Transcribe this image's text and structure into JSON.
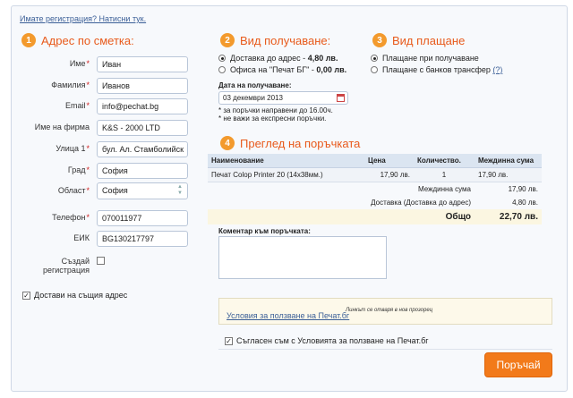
{
  "top_link": "Имате регистрация? Натисни тук.",
  "section1": {
    "num": "1",
    "title": "Адрес по сметка:",
    "fields": {
      "first_name": {
        "label": "Име",
        "value": "Иван"
      },
      "last_name": {
        "label": "Фамилия",
        "value": "Иванов"
      },
      "email": {
        "label": "Email",
        "value": "info@pechat.bg"
      },
      "company": {
        "label": "Име на фирма",
        "value": "K&S - 2000 LTD"
      },
      "street": {
        "label": "Улица 1",
        "value": "бул. Ал. Стамболийск"
      },
      "city": {
        "label": "Грaд",
        "value": "София"
      },
      "region": {
        "label": "Област",
        "value": "София"
      },
      "phone": {
        "label": "Телефон",
        "value": "070011977"
      },
      "eik": {
        "label": "ЕИК",
        "value": "BG130217797"
      }
    },
    "create_reg": {
      "label_1": "Създай",
      "label_2": "регистрация"
    },
    "same_address": "Достави на същия адрес"
  },
  "section2": {
    "num": "2",
    "title": "Вид получаване:",
    "option1_text": "Доставка до адрес - ",
    "option1_price": "4,80 лв.",
    "option2_text": "Офиса на \"Печат БГ\" - ",
    "option2_price": "0,00 лв.",
    "date_label": "Дата на получаване:",
    "date_value": "03 декември 2013",
    "note1": "* за поръчки направени до 16.00ч.",
    "note2": "* не важи за експресни поръчки."
  },
  "section3": {
    "num": "3",
    "title": "Вид плащане",
    "option1": "Плащане при получаване",
    "option2": "Плащане с банков трансфер",
    "help": "(?)"
  },
  "section4": {
    "num": "4",
    "title": "Преглед на поръчката",
    "headers": {
      "name": "Наименование",
      "price": "Цена",
      "qty": "Количество.",
      "subtotal": "Междинна сума"
    },
    "item": {
      "name": "Печат Colop Printer 20 (14x38мм.)",
      "price": "17,90 лв.",
      "qty": "1",
      "subtotal": "17,90 лв."
    },
    "subtotal_label": "Междинна сума",
    "subtotal_value": "17,90 лв.",
    "delivery_label": "Доставка (Доставка до адрес)",
    "delivery_value": "4,80 лв.",
    "total_label": "Общо",
    "total_value": "22,70 лв."
  },
  "comment_label": "Коментар към поръчката:",
  "terms_link": "Условия за ползване на Печат.бг",
  "terms_hint": "Линкът се отваря в нов прозорец",
  "agree": "Съгласен съм с Условията за ползване на Печат.бг",
  "submit": "Поръчай"
}
